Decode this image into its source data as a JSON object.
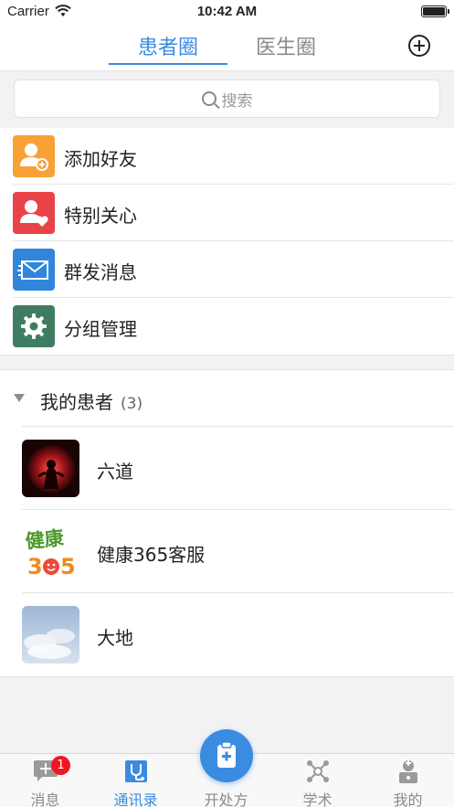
{
  "status_bar": {
    "carrier": "Carrier",
    "time": "10:42 AM"
  },
  "nav": {
    "tab_active": "患者圈",
    "tab_inactive": "医生圈"
  },
  "search": {
    "placeholder": "搜索"
  },
  "menu": {
    "items": [
      {
        "label": "添加好友",
        "color": "#f7a136",
        "icon": "add-friend-icon"
      },
      {
        "label": "特别关心",
        "color": "#e9434a",
        "icon": "special-care-icon"
      },
      {
        "label": "群发消息",
        "color": "#2f86db",
        "icon": "mass-message-icon"
      },
      {
        "label": "分组管理",
        "color": "#3f7d63",
        "icon": "gear-icon"
      }
    ]
  },
  "group": {
    "title": "我的患者",
    "count": "(3)",
    "patients": [
      {
        "name": "六道",
        "avatar": "dark-red-avatar"
      },
      {
        "name": "健康365客服",
        "avatar": "health365-logo-avatar"
      },
      {
        "name": "大地",
        "avatar": "sky-avatar"
      }
    ]
  },
  "tabbar": {
    "items": [
      {
        "label": "消息",
        "icon": "message-icon",
        "badge": "1"
      },
      {
        "label": "通讯录",
        "icon": "contacts-icon"
      },
      {
        "label": "开处方",
        "icon": "prescription-icon"
      },
      {
        "label": "学术",
        "icon": "academic-icon"
      },
      {
        "label": "我的",
        "icon": "profile-icon"
      }
    ]
  },
  "colors": {
    "accent": "#3b8be0",
    "badge": "#f0151f"
  }
}
